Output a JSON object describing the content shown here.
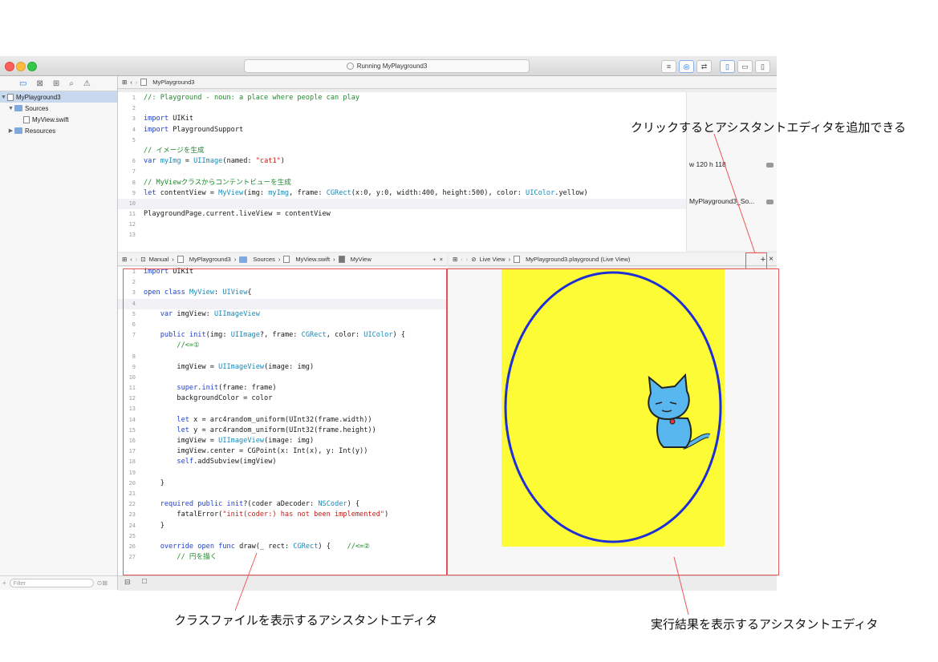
{
  "window": {
    "activity_text": "Running MyPlayground3"
  },
  "navigator": {
    "items": [
      {
        "label": "MyPlayground3"
      },
      {
        "label": "Sources"
      },
      {
        "label": "MyView.swift"
      },
      {
        "label": "Resources"
      }
    ],
    "filter_placeholder": "Filter"
  },
  "main_editor": {
    "breadcrumb": "MyPlayground3",
    "lines": [
      "//: Playground - noun: a place where people can play",
      "",
      "import UIKit",
      "import PlaygroundSupport",
      "",
      "// イメージを生成",
      "var myImg = UIImage(named: \"cat1\")",
      "",
      "// MyViewクラスからコンテントビューを生成",
      "let contentView = MyView(img: myImg, frame: CGRect(x:0, y:0, width:400, height:500), color: UIColor.yellow)",
      "",
      "PlaygroundPage.current.liveView = contentView",
      "",
      ""
    ],
    "results": {
      "img_size": "w 120 h 118",
      "content_view": "MyPlayground3_So..."
    }
  },
  "assistant_left": {
    "breadcrumb": [
      "Manual",
      "MyPlayground3",
      "Sources",
      "MyView.swift",
      "MyView"
    ],
    "lines": [
      "import UIKit",
      "",
      "open class MyView: UIView{",
      "",
      "    var imgView: UIImageView",
      "",
      "    public init(img: UIImage?, frame: CGRect, color: UIColor) {",
      "        //<=①",
      "",
      "        imgView = UIImageView(image: img)",
      "",
      "        super.init(frame: frame)",
      "        backgroundColor = color",
      "",
      "        let x = arc4random_uniform(UInt32(frame.width))",
      "        let y = arc4random_uniform(UInt32(frame.height))",
      "        imgView = UIImageView(image: img)",
      "        imgView.center = CGPoint(x: Int(x), y: Int(y))",
      "        self.addSubview(imgView)",
      "",
      "    }",
      "",
      "    required public init?(coder aDecoder: NSCoder) {",
      "        fatalError(\"init(coder:) has not been implemented\")",
      "    }",
      "",
      "    override open func draw(_ rect: CGRect) {    //<=②",
      "        // 円を描く"
    ]
  },
  "assistant_right": {
    "breadcrumb": [
      "Live View",
      "MyPlayground3.playground (Live View)"
    ]
  },
  "callouts": {
    "add_editor": "クリックするとアシスタントエディタを追加できる",
    "class_editor": "クラスファイルを表示するアシスタントエディタ",
    "live_editor": "実行結果を表示するアシスタントエディタ"
  },
  "colors": {
    "live_background": "#fdfb36",
    "oval_stroke": "#1f2fd6",
    "cat_body": "#58b7ee",
    "annotation_red": "#e55555"
  }
}
